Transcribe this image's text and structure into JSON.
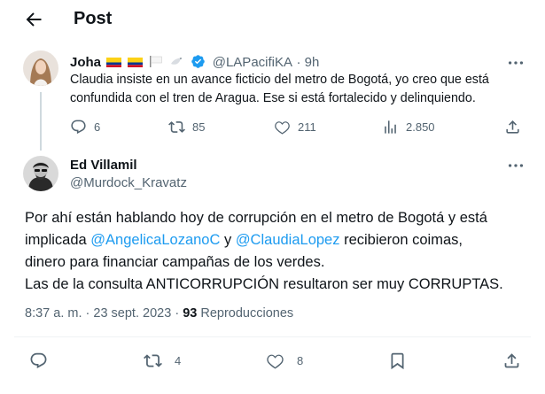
{
  "header": {
    "title": "Post",
    "back_icon": "arrow-left-icon"
  },
  "parent_tweet": {
    "author_name": "Joha",
    "flags": [
      "colombia-flag",
      "colombia-flag",
      "white-flag",
      "dove"
    ],
    "handle": "@LAPacifiKA",
    "time": "9h",
    "text_line1": "Claudia insiste en un avance ficticio del metro de Bogotá, yo creo que está",
    "text_line2": "confundida con el tren de Aragua. Ese si está fortalecido y delinquiendo.",
    "metrics": {
      "replies": "6",
      "reposts": "85",
      "likes": "211",
      "views": "2.850"
    }
  },
  "main_tweet": {
    "author_name": "Ed Villamil",
    "handle": "@Murdock_Kravatz",
    "line1": "Por ahí están hablando hoy de corrupción en el metro de Bogotá y está",
    "line2_a": "implicada ",
    "mention1": "@AngelicaLozanoC",
    "line2_b": " y ",
    "mention2": "@ClaudiaLopez",
    "line2_c": " recibieron coimas,",
    "line3": "dinero para financiar campañas de los verdes.",
    "line4": "Las de la consulta ANTICORRUPCIÓN resultaron ser muy CORRUPTAS.",
    "time": "8:37 a. m.",
    "sep": "·",
    "date": "23 sept. 2023",
    "views_count": "93",
    "views_label": "Reproducciones",
    "actions": {
      "reposts": "4",
      "likes": "8"
    }
  },
  "colors": {
    "accent": "#1d9bf0",
    "muted": "#536471",
    "divider": "#eff3f4"
  }
}
